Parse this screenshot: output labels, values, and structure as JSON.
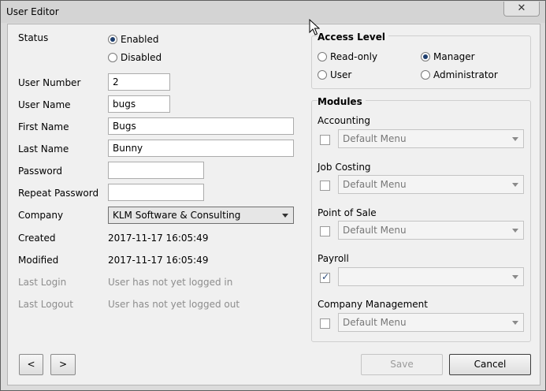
{
  "window": {
    "title": "User Editor",
    "close_glyph": "✕"
  },
  "status": {
    "label": "Status",
    "options": [
      {
        "label": "Enabled",
        "selected": true
      },
      {
        "label": "Disabled",
        "selected": false
      }
    ]
  },
  "fields": {
    "user_number": {
      "label": "User Number",
      "value": "2"
    },
    "user_name": {
      "label": "User Name",
      "value": "bugs"
    },
    "first_name": {
      "label": "First Name",
      "value": "Bugs"
    },
    "last_name": {
      "label": "Last Name",
      "value": "Bunny"
    },
    "password": {
      "label": "Password",
      "value": ""
    },
    "repeat_password": {
      "label": "Repeat Password",
      "value": ""
    },
    "company": {
      "label": "Company",
      "value": "KLM Software & Consulting"
    },
    "created": {
      "label": "Created",
      "value": "2017-11-17 16:05:49"
    },
    "modified": {
      "label": "Modified",
      "value": "2017-11-17 16:05:49"
    },
    "last_login": {
      "label": "Last Login",
      "value": "User has not yet logged in"
    },
    "last_logout": {
      "label": "Last Logout",
      "value": "User has not yet logged out"
    }
  },
  "access_level": {
    "title": "Access Level",
    "options": [
      {
        "label": "Read-only",
        "selected": false
      },
      {
        "label": "Manager",
        "selected": true
      },
      {
        "label": "User",
        "selected": false
      },
      {
        "label": "Administrator",
        "selected": false
      }
    ]
  },
  "modules": {
    "title": "Modules",
    "items": [
      {
        "label": "Accounting",
        "checked": false,
        "menu": "Default Menu"
      },
      {
        "label": "Job Costing",
        "checked": false,
        "menu": "Default Menu"
      },
      {
        "label": "Point of Sale",
        "checked": false,
        "menu": "Default Menu"
      },
      {
        "label": "Payroll",
        "checked": true,
        "menu": ""
      },
      {
        "label": "Company Management",
        "checked": false,
        "menu": "Default Menu"
      }
    ]
  },
  "nav": {
    "prev": "<",
    "next": ">"
  },
  "buttons": {
    "save": "Save",
    "cancel": "Cancel"
  },
  "icons": {
    "close": "close-icon",
    "cursor": "mouse-pointer-icon",
    "dropdown": "chevron-down-icon",
    "checkmark": "checkmark-icon"
  }
}
